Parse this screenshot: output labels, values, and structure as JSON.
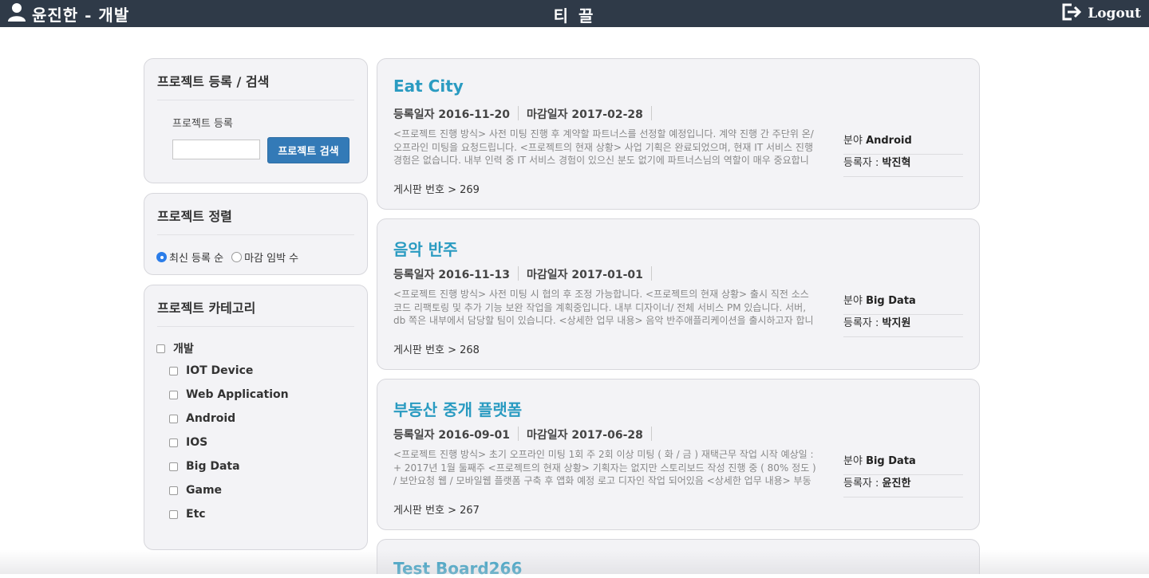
{
  "topbar": {
    "user_name": "윤진한 - 개발",
    "brand": "티 끌",
    "logout_label": "Logout"
  },
  "register_panel": {
    "title": "프로젝트 등록 / 검색",
    "sub_label": "프로젝트 등록",
    "search_value": "",
    "search_button": "프로젝트 검색"
  },
  "sort_panel": {
    "title": "프로젝트 정렬",
    "options": [
      {
        "label": "최신 등록 순",
        "selected": true
      },
      {
        "label": "마감 임박 수",
        "selected": false
      }
    ]
  },
  "category_panel": {
    "title": "프로젝트 카테고리",
    "parent": "개발",
    "children": [
      "IOT Device",
      "Web Application",
      "Android",
      "IOS",
      "Big Data",
      "Game",
      "Etc"
    ]
  },
  "projects": [
    {
      "title": "Eat City",
      "reg_date": "등록일자 2016-11-20",
      "due_date": "마감일자 2017-02-28",
      "desc": "<프로젝트 진행 방식> 사전 미팅 진행 후 계약할 파트너스를 선정할 예정입니다. 계약 진행 간 주단위 온/오프라인 미팅을 요청드립니다. <프로젝트의 현재 상황> 사업 기획은 완료되었으며, 현재 IT 서비스 진행 경험은 없습니다. 내부 인력 중 IT 서비스 경험이 있으신 분도 없기에 파트너스님의 역할이 매우 중요합니",
      "field_label": "분야",
      "field": "Android",
      "author_label": "등록자 :",
      "author": "박진혁",
      "board": "게시판 번호 > 269"
    },
    {
      "title": "음악 반주",
      "reg_date": "등록일자 2016-11-13",
      "due_date": "마감일자 2017-01-01",
      "desc": "<프로젝트 진행 방식> 사전 미팅 시 협의 후 조정 가능합니다. <프로젝트의 현재 상황> 출시 직전 소스코드 리팩토링 및 추가 기능 보완 작업을 계획중입니다. 내부 디자이너/ 전체 서비스 PM 있습니다. 서버, db 쪽은 내부에서 담당할 팀이 있습니다. <상세한 업무 내용> 음악 반주애플리케이션을 출시하고자 합니",
      "field_label": "분야",
      "field": "Big Data",
      "author_label": "등록자 :",
      "author": "박지원",
      "board": "게시판 번호 > 268"
    },
    {
      "title": "부동산 중개 플랫폼",
      "reg_date": "등록일자 2016-09-01",
      "due_date": "마감일자 2017-06-28",
      "desc": "<프로젝트 진행 방식> 초기 오프라인 미팅 1회 주 2회 이상 미팅 ( 화 / 금 ) 재택근무 작업 시작 예상일 : + 2017년 1월 둘째주 <프로젝트의 현재 상황> 기획자는 없지만 스토리보드 작성 진행 중 ( 80% 정도 ) / 보안요청 웹 / 모바일웹 플랫폼 구축 후 앱화 예정 로고 디자인 작업 되어있음 <상세한 업무 내용> 부동",
      "field_label": "분야",
      "field": "Big Data",
      "author_label": "등록자 :",
      "author": "윤진한",
      "board": "게시판 번호 > 267"
    },
    {
      "title": "Test Board266"
    }
  ]
}
